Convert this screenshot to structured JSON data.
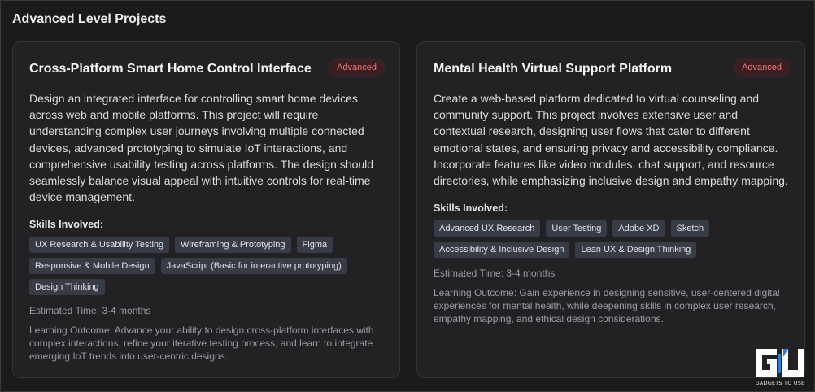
{
  "section": {
    "title": "Advanced Level Projects"
  },
  "cards": [
    {
      "title": "Cross-Platform Smart Home Control Interface",
      "badge": "Advanced",
      "description": "Design an integrated interface for controlling smart home devices across web and mobile platforms. This project will require understanding complex user journeys involving multiple connected devices, advanced prototyping to simulate IoT interactions, and comprehensive usability testing across platforms. The design should seamlessly balance visual appeal with intuitive controls for real-time device management.",
      "skills_label": "Skills Involved:",
      "skills": [
        "UX Research & Usability Testing",
        "Wireframing & Prototyping",
        "Figma",
        "Responsive & Mobile Design",
        "JavaScript (Basic for interactive prototyping)",
        "Design Thinking"
      ],
      "estimated_time": "Estimated Time: 3-4 months",
      "learning_outcome": "Learning Outcome: Advance your ability to design cross-platform interfaces with complex interactions, refine your iterative testing process, and learn to integrate emerging IoT trends into user-centric designs."
    },
    {
      "title": "Mental Health Virtual Support Platform",
      "badge": "Advanced",
      "description": "Create a web-based platform dedicated to virtual counseling and community support. This project involves extensive user and contextual research, designing user flows that cater to different emotional states, and ensuring privacy and accessibility compliance. Incorporate features like video modules, chat support, and resource directories, while emphasizing inclusive design and empathy mapping.",
      "skills_label": "Skills Involved:",
      "skills": [
        "Advanced UX Research",
        "User Testing",
        "Adobe XD",
        "Sketch",
        "Accessibility & Inclusive Design",
        "Lean UX & Design Thinking"
      ],
      "estimated_time": "Estimated Time: 3-4 months",
      "learning_outcome": "Learning Outcome: Gain experience in designing sensitive, user-centered digital experiences for mental health, while deepening skills in complex user research, empathy mapping, and ethical design considerations."
    }
  ],
  "watermark": {
    "text": "GADGETS TO USE",
    "icon": "gadgets-to-use-logo"
  },
  "colors": {
    "background": "#1b1b1d",
    "card": "#222225",
    "badge_text": "#f07878",
    "chip_bg": "#373c47"
  }
}
